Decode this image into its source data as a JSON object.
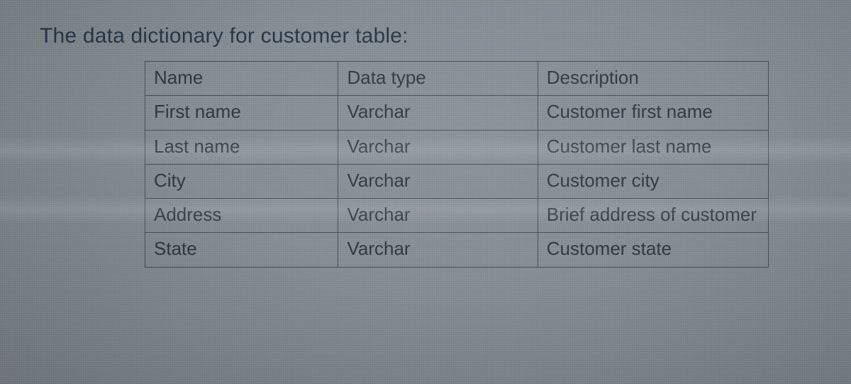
{
  "title": "The data dictionary for customer table:",
  "headers": {
    "name": "Name",
    "type": "Data type",
    "desc": "Description"
  },
  "rows": [
    {
      "name": "First name",
      "type": "Varchar",
      "desc": "Customer first name"
    },
    {
      "name": "Last name",
      "type": "Varchar",
      "desc": "Customer last name"
    },
    {
      "name": "City",
      "type": "Varchar",
      "desc": "Customer city"
    },
    {
      "name": "Address",
      "type": "Varchar",
      "desc": "Brief address of customer"
    },
    {
      "name": "State",
      "type": "Varchar",
      "desc": "Customer state"
    }
  ]
}
